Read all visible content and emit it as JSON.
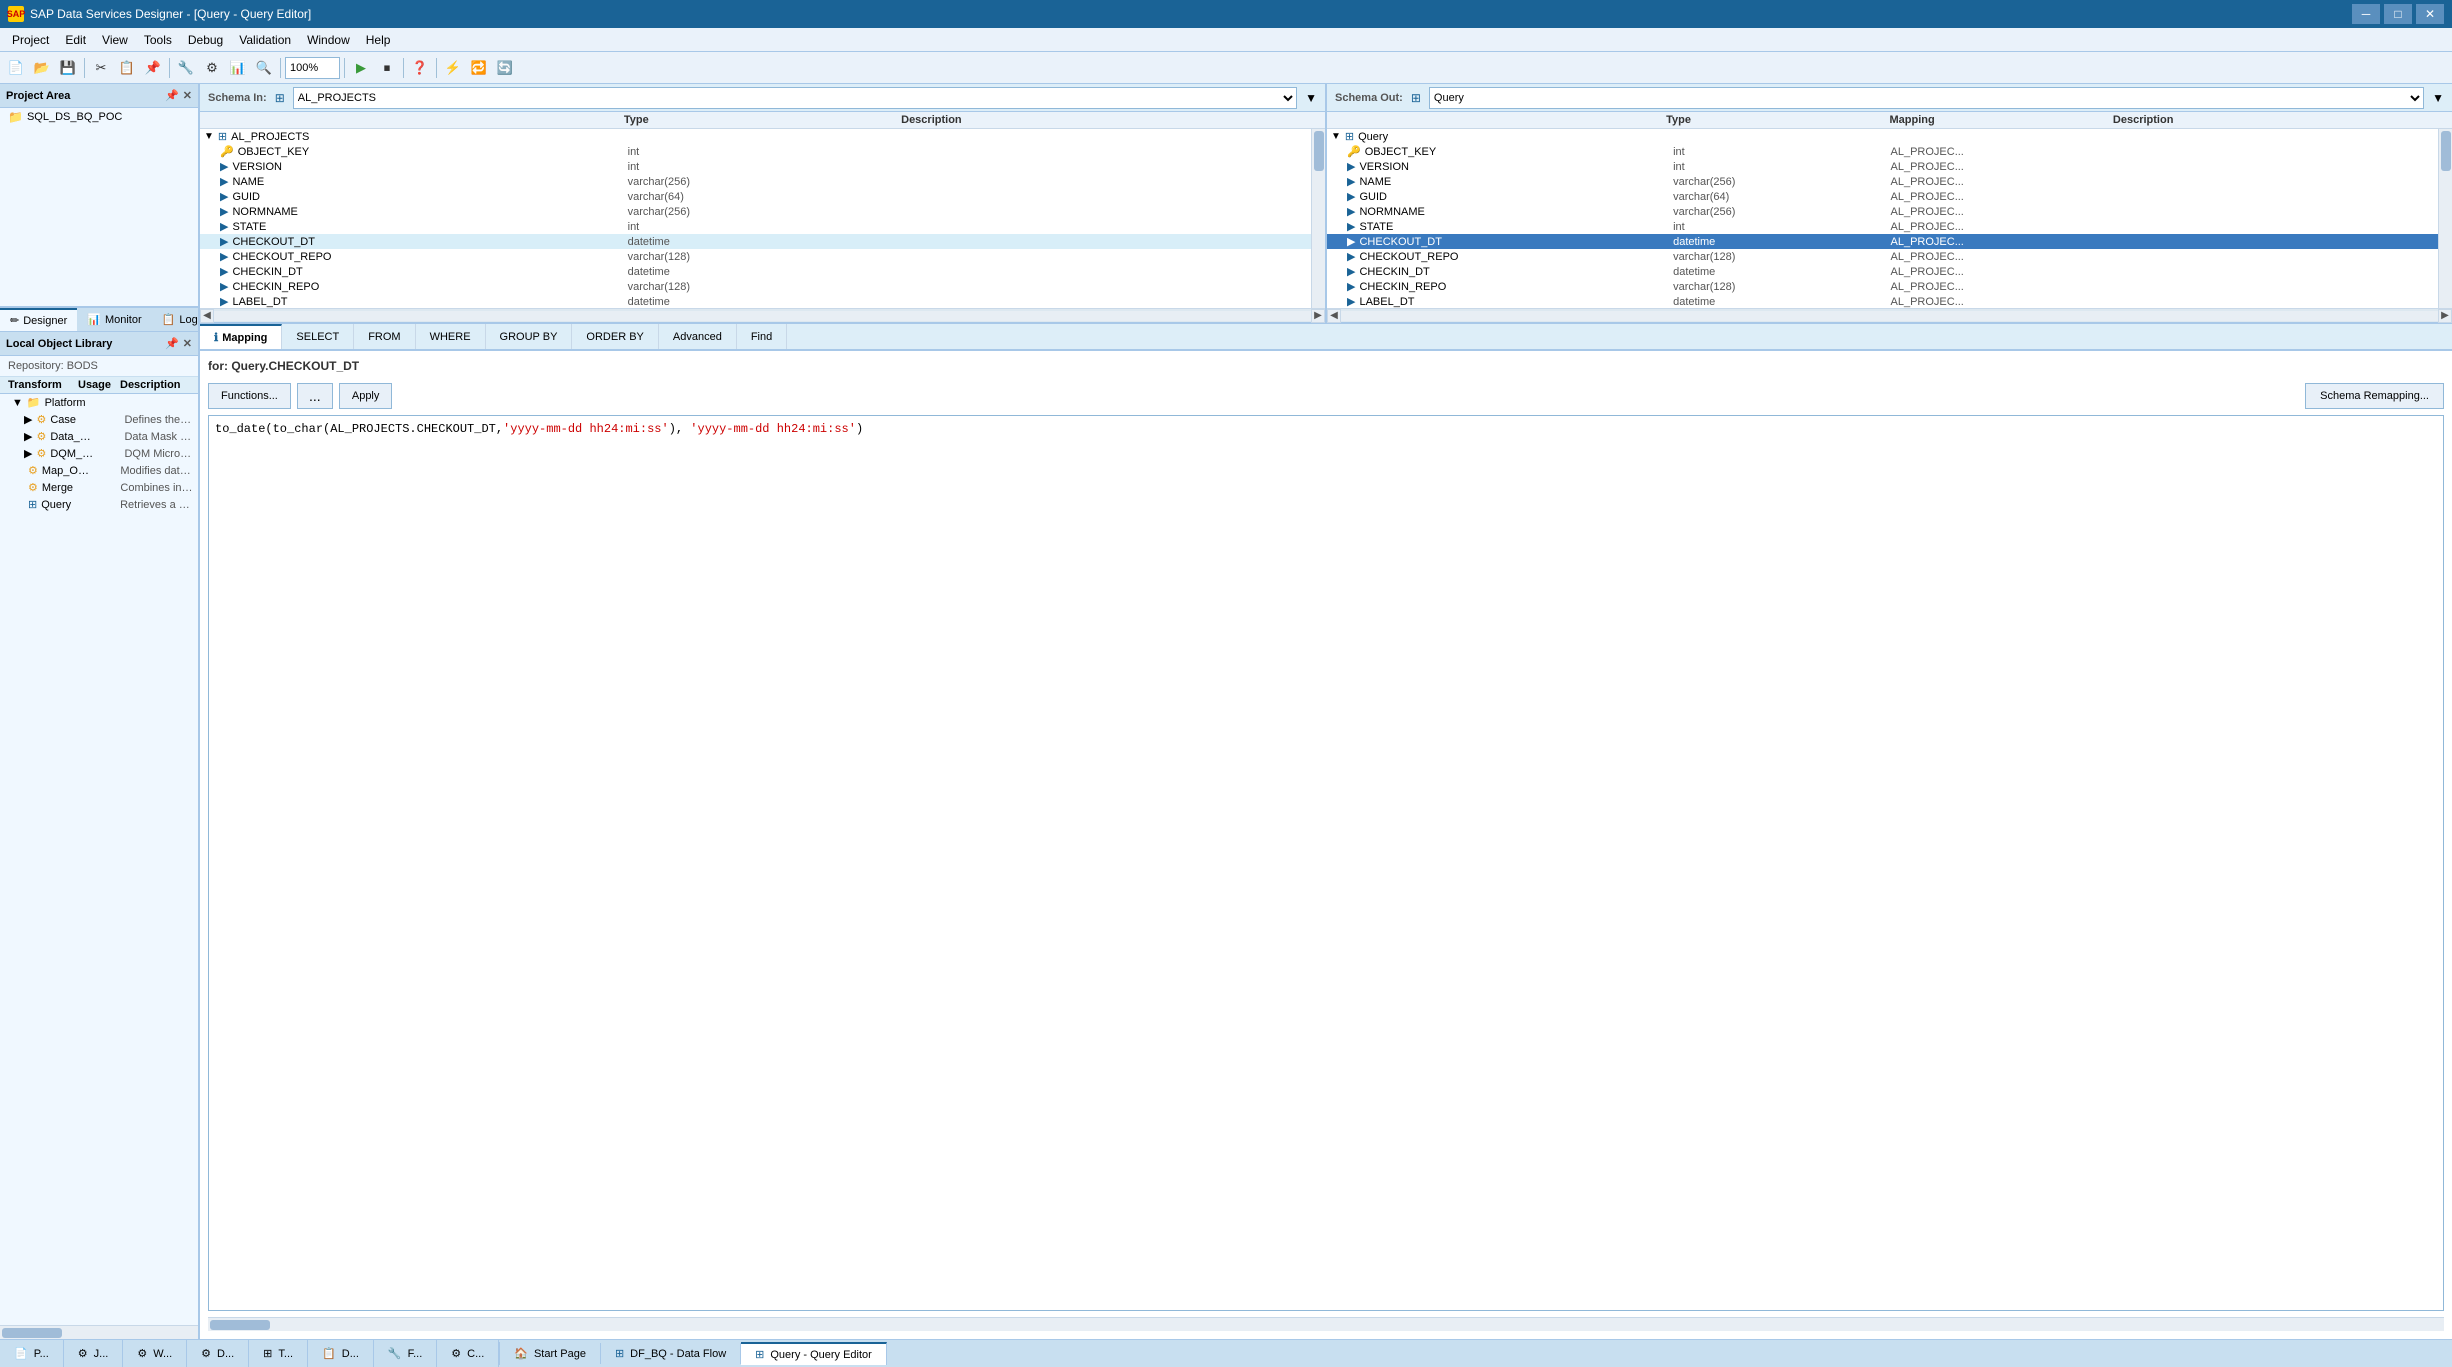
{
  "title": {
    "app": "SAP Data Services Designer",
    "window": "[Query - Query Editor]",
    "full": "SAP Data Services Designer - [Query - Query Editor]"
  },
  "menu": {
    "items": [
      "Project",
      "Edit",
      "View",
      "Tools",
      "Debug",
      "Validation",
      "Window",
      "Help"
    ]
  },
  "toolbar": {
    "zoom": "100%"
  },
  "project_area": {
    "label": "Project Area",
    "items": [
      {
        "name": "SQL_DS_BQ_POC",
        "type": "folder"
      }
    ]
  },
  "bottom_nav_tabs": [
    {
      "id": "designer",
      "label": "Designer",
      "active": true
    },
    {
      "id": "monitor",
      "label": "Monitor",
      "active": false
    },
    {
      "id": "log",
      "label": "Log",
      "active": false
    }
  ],
  "local_lib": {
    "header": "Local Object Library",
    "repo": "Repository: BODS",
    "columns": [
      "Transform",
      "Usage",
      "Description"
    ],
    "items": [
      {
        "name": "Platform",
        "level": 1,
        "type": "folder",
        "usage": "",
        "desc": ""
      },
      {
        "name": "Case",
        "level": 2,
        "type": "item",
        "usage": "",
        "desc": "Defines the proce..."
      },
      {
        "name": "Data_Mask",
        "level": 2,
        "type": "item",
        "usage": "",
        "desc": "Data Mask Base Tr..."
      },
      {
        "name": "DQM_Microser...",
        "level": 2,
        "type": "item",
        "usage": "",
        "desc": "DQM Microservic..."
      },
      {
        "name": "Map_Operation",
        "level": 2,
        "type": "item",
        "usage": "",
        "desc": "Modifies data bas..."
      },
      {
        "name": "Merge",
        "level": 2,
        "type": "item",
        "usage": "",
        "desc": "Combines incom..."
      },
      {
        "name": "Query",
        "level": 2,
        "type": "item",
        "usage": "",
        "desc": "Retrieves a data se..."
      }
    ]
  },
  "schema_in": {
    "label": "Schema In:",
    "selected": "AL_PROJECTS",
    "columns": [
      "",
      "Type",
      "Description"
    ],
    "table_name": "AL_PROJECTS",
    "rows": [
      {
        "name": "OBJECT_KEY",
        "type": "int",
        "desc": "",
        "icon": "key"
      },
      {
        "name": "VERSION",
        "type": "int",
        "desc": "",
        "icon": "arrow"
      },
      {
        "name": "NAME",
        "type": "varchar(256)",
        "desc": "",
        "icon": "arrow"
      },
      {
        "name": "GUID",
        "type": "varchar(64)",
        "desc": "",
        "icon": "arrow"
      },
      {
        "name": "NORMNAME",
        "type": "varchar(256)",
        "desc": "",
        "icon": "arrow"
      },
      {
        "name": "STATE",
        "type": "int",
        "desc": "",
        "icon": "arrow"
      },
      {
        "name": "CHECKOUT_DT",
        "type": "datetime",
        "desc": "",
        "icon": "arrow",
        "highlighted": true
      },
      {
        "name": "CHECKOUT_REPO",
        "type": "varchar(128)",
        "desc": "",
        "icon": "arrow"
      },
      {
        "name": "CHECKIN_DT",
        "type": "datetime",
        "desc": "",
        "icon": "arrow"
      },
      {
        "name": "CHECKIN_REPO",
        "type": "varchar(128)",
        "desc": "",
        "icon": "arrow"
      },
      {
        "name": "LABEL_DT",
        "type": "datetime",
        "desc": "",
        "icon": "arrow"
      }
    ]
  },
  "schema_out": {
    "label": "Schema Out:",
    "selected": "Query",
    "columns": [
      "",
      "Type",
      "Mapping",
      "Description"
    ],
    "table_name": "Query",
    "rows": [
      {
        "name": "OBJECT_KEY",
        "type": "int",
        "mapping": "AL_PROJEC...",
        "desc": "",
        "icon": "key",
        "selected": false
      },
      {
        "name": "VERSION",
        "type": "int",
        "mapping": "AL_PROJEC...",
        "desc": "",
        "icon": "arrow",
        "selected": false
      },
      {
        "name": "NAME",
        "type": "varchar(256)",
        "mapping": "AL_PROJEC...",
        "desc": "",
        "icon": "arrow",
        "selected": false
      },
      {
        "name": "GUID",
        "type": "varchar(64)",
        "mapping": "AL_PROJEC...",
        "desc": "",
        "icon": "arrow",
        "selected": false
      },
      {
        "name": "NORMNAME",
        "type": "varchar(256)",
        "mapping": "AL_PROJEC...",
        "desc": "",
        "icon": "arrow",
        "selected": false
      },
      {
        "name": "STATE",
        "type": "int",
        "mapping": "AL_PROJEC...",
        "desc": "",
        "icon": "arrow",
        "selected": false
      },
      {
        "name": "CHECKOUT_DT",
        "type": "datetime",
        "mapping": "AL_PROJEC...",
        "desc": "",
        "icon": "arrow",
        "selected": true
      },
      {
        "name": "CHECKOUT_REPO",
        "type": "varchar(128)",
        "mapping": "AL_PROJEC...",
        "desc": "",
        "icon": "arrow",
        "selected": false
      },
      {
        "name": "CHECKIN_DT",
        "type": "datetime",
        "mapping": "AL_PROJEC...",
        "desc": "",
        "icon": "arrow",
        "selected": false
      },
      {
        "name": "CHECKIN_REPO",
        "type": "varchar(128)",
        "mapping": "AL_PROJEC...",
        "desc": "",
        "icon": "arrow",
        "selected": false
      },
      {
        "name": "LABEL_DT",
        "type": "datetime",
        "mapping": "AL_PROJEC...",
        "desc": "",
        "icon": "arrow",
        "selected": false
      }
    ]
  },
  "mapping": {
    "tabs": [
      {
        "id": "mapping",
        "label": "Mapping",
        "active": true,
        "icon": "ℹ"
      },
      {
        "id": "select",
        "label": "SELECT",
        "active": false
      },
      {
        "id": "from",
        "label": "FROM",
        "active": false
      },
      {
        "id": "where",
        "label": "WHERE",
        "active": false
      },
      {
        "id": "group_by",
        "label": "GROUP BY",
        "active": false
      },
      {
        "id": "order_by",
        "label": "ORDER BY",
        "active": false
      },
      {
        "id": "advanced",
        "label": "Advanced",
        "active": false
      },
      {
        "id": "find",
        "label": "Find",
        "active": false
      }
    ],
    "for_label": "for: Query.CHECKOUT_DT",
    "buttons": {
      "functions": "Functions...",
      "dots": "...",
      "apply": "Apply",
      "schema_remapping": "Schema Remapping..."
    },
    "code": "to_date(to_char(AL_PROJECTS.CHECKOUT_DT,'yyyy-mm-dd hh24:mi:ss'), 'yyyy-mm-dd hh24:mi:ss')"
  },
  "status_tabs": [
    {
      "id": "project",
      "label": "P...",
      "active": false
    },
    {
      "id": "job",
      "label": "J...",
      "active": false
    },
    {
      "id": "work",
      "label": "W...",
      "active": false
    },
    {
      "id": "df",
      "label": "D...",
      "active": false
    },
    {
      "id": "t",
      "label": "T...",
      "active": false
    },
    {
      "id": "d2",
      "label": "D...",
      "active": false
    },
    {
      "id": "f",
      "label": "F...",
      "active": false
    },
    {
      "id": "c",
      "label": "C...",
      "active": false
    }
  ],
  "bottom_status_tabs": [
    {
      "id": "start",
      "label": "Start Page",
      "active": false
    },
    {
      "id": "df_bq",
      "label": "DF_BQ - Data Flow",
      "active": false
    },
    {
      "id": "query_editor",
      "label": "Query - Query Editor",
      "active": true
    }
  ]
}
